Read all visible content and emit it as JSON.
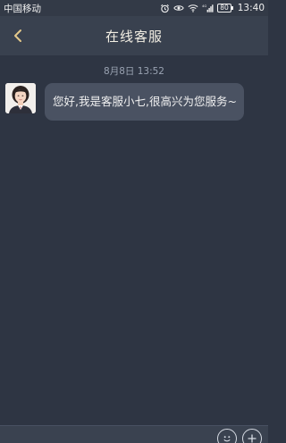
{
  "status_bar": {
    "carrier": "中国移动",
    "battery": "80",
    "time": "13:40",
    "network": "4G"
  },
  "header": {
    "title": "在线客服"
  },
  "chat": {
    "timestamp": "8月8日 13:52",
    "messages": [
      {
        "sender": "agent",
        "avatar": "service-agent-avatar",
        "text": "您好,我是客服小七,很高兴为您服务~"
      }
    ]
  },
  "input_bar": {
    "buttons": [
      "emoji-icon",
      "plus-icon"
    ]
  },
  "colors": {
    "background": "#2e3543",
    "header": "#39414f",
    "bubble": "#4a5262",
    "title_text": "#f3efe4"
  }
}
